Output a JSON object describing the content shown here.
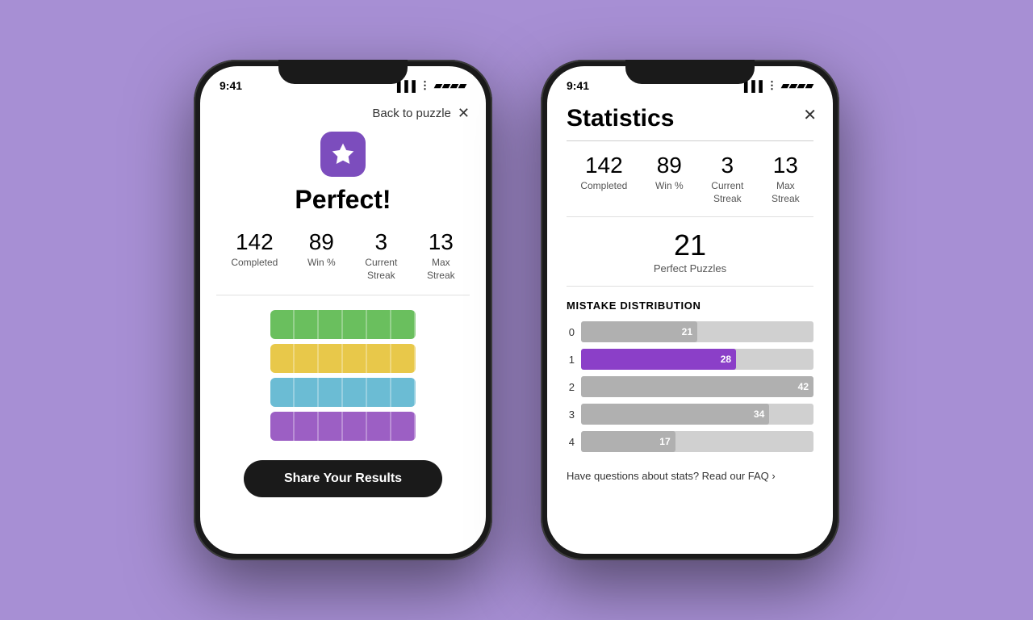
{
  "background": "#a78fd4",
  "phone1": {
    "time": "9:41",
    "back_label": "Back to puzzle",
    "star_icon": "★",
    "perfect_title": "Perfect!",
    "stats": [
      {
        "number": "142",
        "label": "Completed"
      },
      {
        "number": "89",
        "label": "Win %"
      },
      {
        "number": "3",
        "label": "Current\nStreak"
      },
      {
        "number": "13",
        "label": "Max\nStreak"
      }
    ],
    "share_button": "Share Your Results",
    "colors": [
      "green",
      "yellow",
      "blue",
      "purple"
    ]
  },
  "phone2": {
    "time": "9:41",
    "title": "Statistics",
    "stats": [
      {
        "number": "142",
        "label": "Completed"
      },
      {
        "number": "89",
        "label": "Win %"
      },
      {
        "number": "3",
        "label": "Current\nStreak"
      },
      {
        "number": "13",
        "label": "Max\nStreak"
      }
    ],
    "perfect_puzzles_number": "21",
    "perfect_puzzles_label": "Perfect Puzzles",
    "mistake_distribution_title": "MISTAKE DISTRIBUTION",
    "bars": [
      {
        "index": "0",
        "value": 21,
        "max": 42,
        "type": "gray"
      },
      {
        "index": "1",
        "value": 28,
        "max": 42,
        "type": "purple"
      },
      {
        "index": "2",
        "value": 42,
        "max": 42,
        "type": "gray"
      },
      {
        "index": "3",
        "value": 34,
        "max": 42,
        "type": "gray"
      },
      {
        "index": "4",
        "value": 17,
        "max": 42,
        "type": "gray"
      }
    ],
    "faq_text": "Have questions about stats? Read our FAQ ›"
  }
}
